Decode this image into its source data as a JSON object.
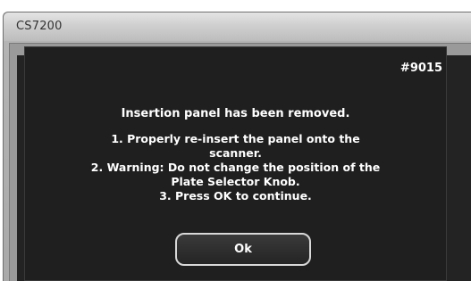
{
  "window": {
    "title": "CS7200"
  },
  "dialog": {
    "error_code": "#9015",
    "heading": "Insertion panel has been removed.",
    "instructions": [
      "1. Properly re-insert the panel onto the",
      "scanner.",
      "2. Warning: Do not change the position of the",
      "Plate Selector Knob.",
      "3. Press OK to continue."
    ],
    "ok_label": "Ok"
  },
  "colors": {
    "panel_background": "#1f1f1f",
    "text": "#ffffff",
    "window_frame": "#b4b4b4"
  }
}
